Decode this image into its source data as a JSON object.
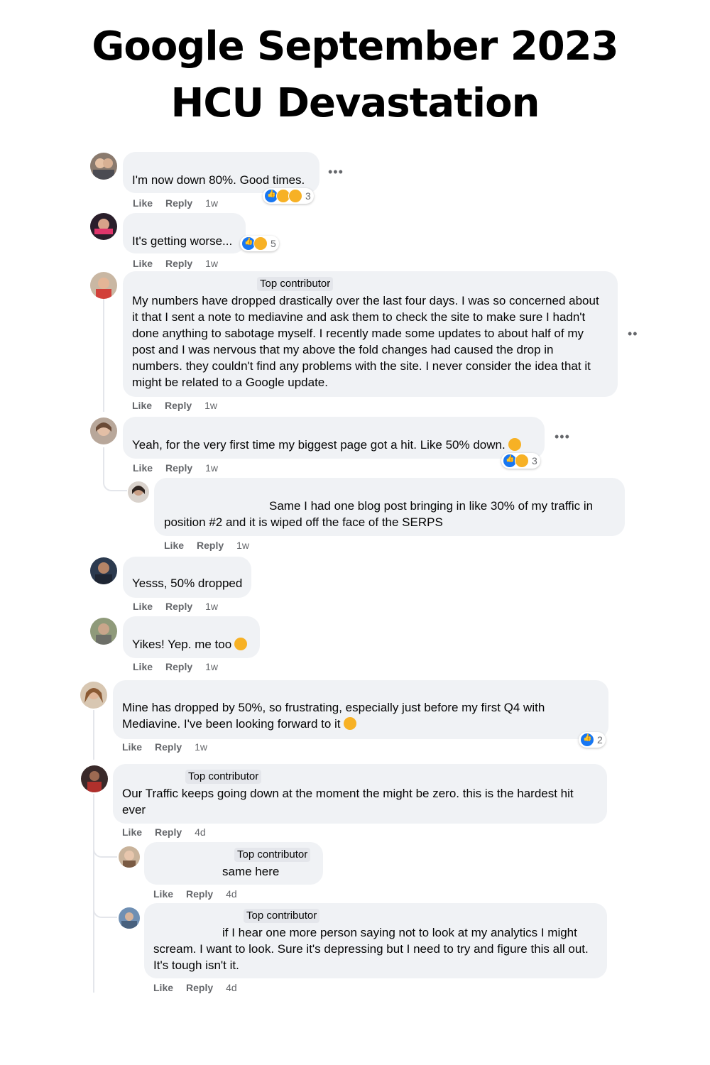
{
  "headline": [
    "Google September 2023",
    "HCU Devastation"
  ],
  "actions": {
    "like": "Like",
    "reply": "Reply"
  },
  "comments": [
    {
      "text": "I'm now down 80%. Good times.",
      "time": "1w",
      "reactions": "3"
    },
    {
      "text": "It's getting worse...",
      "time": "1w",
      "reactions": "5"
    },
    {
      "tag": "Top contributor",
      "lines": [
        "My numbers have dropped drastically over the last four days. I was so concerned about",
        "it that I sent a note to mediavine and ask them to check the site to make sure I hadn't",
        "done anything to sabotage myself. I recently made some updates to about half of my",
        "post and I was nervous that my above the fold changes had caused the drop in",
        "numbers. they couldn't find any problems with the site. I never consider the idea that it",
        "might be related to a Google update."
      ],
      "time": "1w"
    },
    {
      "text": "Yeah, for the very first time my biggest page got a hit. Like 50% down.",
      "time": "1w",
      "reactions": "3"
    },
    {
      "lines": [
        "Same I had one blog post bringing in like 30% of my traffic in",
        "position #2 and it is wiped off the face of the SERPS"
      ],
      "time": "1w"
    },
    {
      "text": "Yesss, 50% dropped",
      "time": "1w"
    },
    {
      "text": "Yikes! Yep. me too",
      "time": "1w"
    },
    {
      "lines": [
        "Mine has dropped by 50%, so frustrating, especially just before my first Q4 with",
        "Mediavine. I've been looking forward to it"
      ],
      "time": "1w",
      "reactions": "2"
    },
    {
      "tag": "Top contributor",
      "lines": [
        "Our Traffic keeps going down at the moment the might be zero. this is the hardest hit",
        "ever"
      ],
      "time": "4d"
    },
    {
      "tag": "Top contributor",
      "text": "same here",
      "time": "4d"
    },
    {
      "tag": "Top contributor",
      "lines": [
        "if I hear one more person saying not to look at my analytics I might",
        "scream. I want to look. Sure it's depressing but I need to try and figure this all out.",
        "It's tough isn't it."
      ],
      "time": "4d"
    }
  ],
  "colors": {
    "bubble": "#f0f2f5",
    "meta": "#65676b",
    "like_blue": "#1877f2",
    "emoji_yellow": "#f7b125"
  },
  "icons": [
    "like-reaction-icon",
    "care-reaction-icon",
    "sad-reaction-icon",
    "more-options-icon",
    "crying-emoji-icon",
    "pleading-emoji-icon"
  ]
}
